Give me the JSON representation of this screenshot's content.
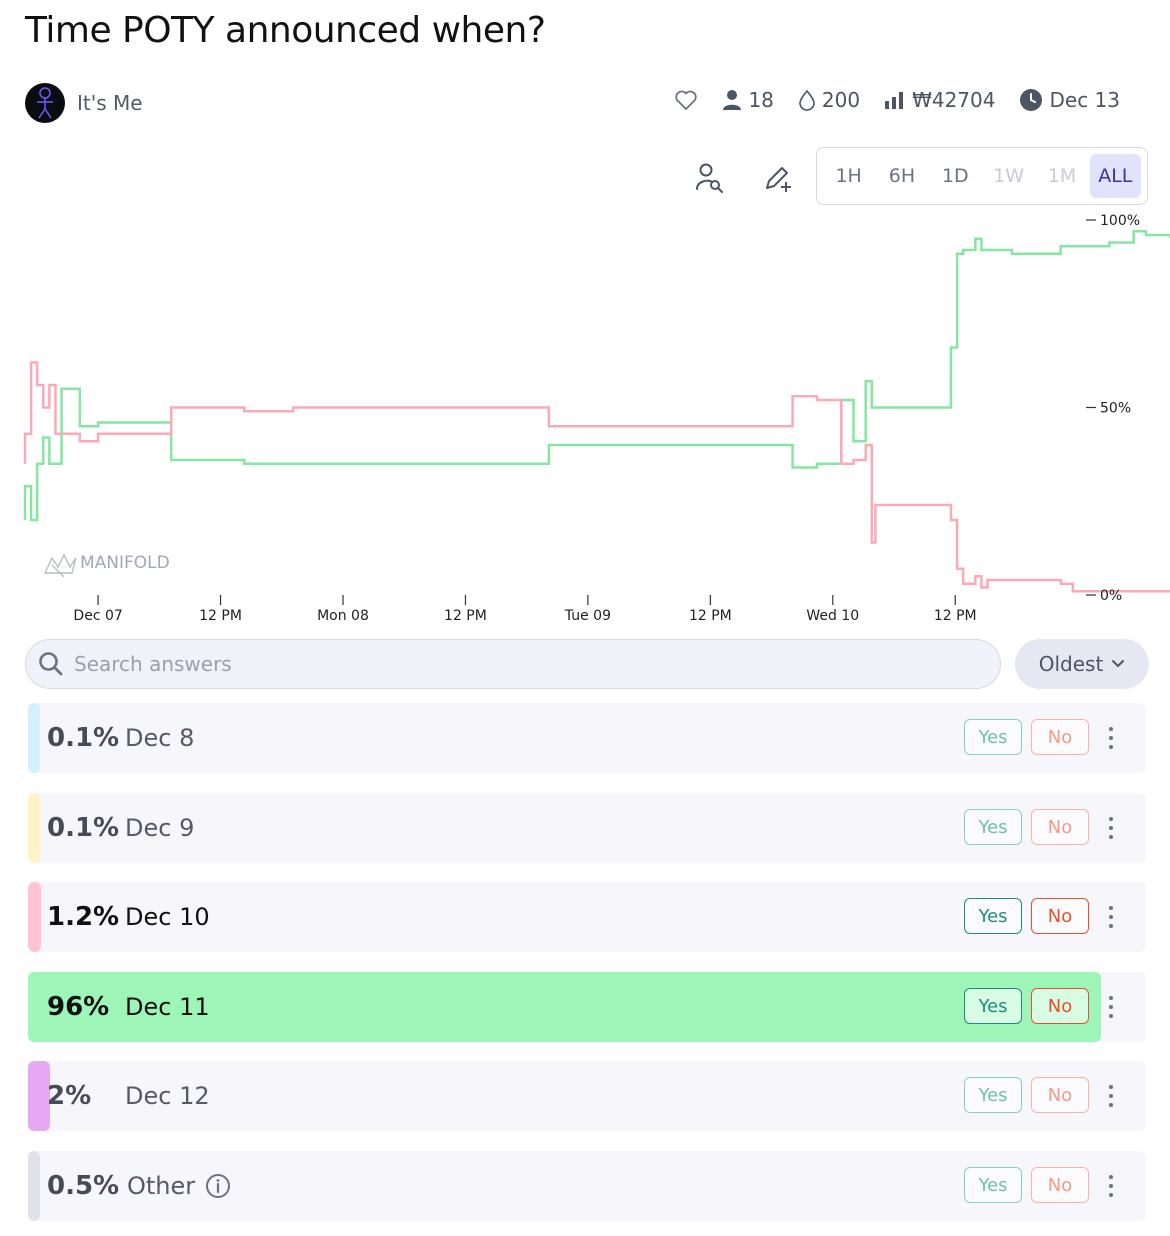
{
  "title": "Time POTY announced when?",
  "author": {
    "name": "It's Me"
  },
  "stats": {
    "traders": "18",
    "liquidity": "200",
    "volume": "₩42704",
    "close_date": "Dec 13"
  },
  "periods": [
    {
      "label": "1H",
      "state": "disabled-ish"
    },
    {
      "label": "6H",
      "state": "enabled"
    },
    {
      "label": "1D",
      "state": "enabled"
    },
    {
      "label": "1W",
      "state": "disabled"
    },
    {
      "label": "1M",
      "state": "disabled"
    },
    {
      "label": "ALL",
      "state": "active"
    }
  ],
  "chart_data": {
    "type": "line",
    "watermark": "MANIFOLD",
    "x_tick_labels": [
      "Dec 07",
      "12 PM",
      "Mon 08",
      "12 PM",
      "Tue 09",
      "12 PM",
      "Wed 10",
      "12 PM"
    ],
    "y_tick_labels": [
      "100%",
      "50%",
      "0%"
    ],
    "ylim": [
      0,
      100
    ],
    "x_unit": "hours since start of chart",
    "xlim": [
      0,
      87
    ],
    "series": [
      {
        "color": "#86e5a0",
        "points": [
          [
            0,
            20
          ],
          [
            0,
            29
          ],
          [
            0.5,
            29
          ],
          [
            0.5,
            20
          ],
          [
            1,
            20
          ],
          [
            1,
            35
          ],
          [
            1.5,
            35
          ],
          [
            1.5,
            42
          ],
          [
            2,
            42
          ],
          [
            2,
            35
          ],
          [
            3,
            35
          ],
          [
            3,
            55
          ],
          [
            4.5,
            55
          ],
          [
            4.5,
            45
          ],
          [
            6,
            45
          ],
          [
            6,
            46
          ],
          [
            12,
            46
          ],
          [
            12,
            36
          ],
          [
            18,
            36
          ],
          [
            18,
            35
          ],
          [
            43,
            35
          ],
          [
            43,
            40
          ],
          [
            63,
            40
          ],
          [
            63,
            34
          ],
          [
            65,
            34
          ],
          [
            65,
            35
          ],
          [
            67,
            35
          ],
          [
            67,
            52
          ],
          [
            68,
            52
          ],
          [
            68,
            41
          ],
          [
            69,
            41
          ],
          [
            69,
            57
          ],
          [
            69.5,
            57
          ],
          [
            69.5,
            50
          ],
          [
            76,
            50
          ],
          [
            76,
            66
          ],
          [
            76.5,
            66
          ],
          [
            76.5,
            91
          ],
          [
            77,
            91
          ],
          [
            77,
            92
          ],
          [
            78,
            92
          ],
          [
            78,
            95
          ],
          [
            78.5,
            95
          ],
          [
            78.5,
            92
          ],
          [
            81,
            92
          ],
          [
            81,
            91
          ],
          [
            85,
            91
          ],
          [
            85,
            93
          ],
          [
            89,
            93
          ],
          [
            89,
            94
          ],
          [
            91,
            94
          ],
          [
            91,
            97
          ],
          [
            92,
            97
          ],
          [
            92,
            96
          ],
          [
            94,
            96
          ],
          [
            94,
            95.5
          ],
          [
            100,
            95.5
          ]
        ]
      },
      {
        "color": "#f9aab7",
        "points": [
          [
            0,
            35
          ],
          [
            0,
            43
          ],
          [
            0.5,
            43
          ],
          [
            0.5,
            62
          ],
          [
            1,
            62
          ],
          [
            1,
            56
          ],
          [
            1.5,
            56
          ],
          [
            1.5,
            50
          ],
          [
            2,
            50
          ],
          [
            2,
            56
          ],
          [
            2.5,
            56
          ],
          [
            2.5,
            43
          ],
          [
            4.5,
            43
          ],
          [
            4.5,
            41
          ],
          [
            6,
            41
          ],
          [
            6,
            43
          ],
          [
            12,
            43
          ],
          [
            12,
            50
          ],
          [
            18,
            50
          ],
          [
            18,
            49
          ],
          [
            22,
            49
          ],
          [
            22,
            50
          ],
          [
            43,
            50
          ],
          [
            43,
            45
          ],
          [
            63,
            45
          ],
          [
            63,
            53
          ],
          [
            65,
            53
          ],
          [
            65,
            52
          ],
          [
            67,
            52
          ],
          [
            67,
            35
          ],
          [
            68,
            35
          ],
          [
            68,
            36
          ],
          [
            69,
            36
          ],
          [
            69,
            40
          ],
          [
            69.5,
            40
          ],
          [
            69.5,
            14
          ],
          [
            69.8,
            14
          ],
          [
            69.8,
            24
          ],
          [
            76,
            24
          ],
          [
            76,
            20
          ],
          [
            76.5,
            20
          ],
          [
            76.5,
            7
          ],
          [
            77,
            7
          ],
          [
            77,
            3
          ],
          [
            78,
            3
          ],
          [
            78,
            5
          ],
          [
            78.5,
            5
          ],
          [
            78.5,
            2
          ],
          [
            79,
            2
          ],
          [
            79,
            4
          ],
          [
            85,
            4
          ],
          [
            85,
            3
          ],
          [
            86,
            3
          ],
          [
            86,
            1
          ],
          [
            100,
            1
          ]
        ]
      }
    ]
  },
  "search": {
    "placeholder": "Search answers"
  },
  "sort": {
    "label": "Oldest"
  },
  "answers": [
    {
      "prob": "0.1%",
      "label": "Dec 8",
      "color": "#d4efff",
      "prob_value": 0.001,
      "yes": "Yes",
      "no": "No"
    },
    {
      "prob": "0.1%",
      "label": "Dec 9",
      "color": "#fff2c8",
      "prob_value": 0.001,
      "yes": "Yes",
      "no": "No"
    },
    {
      "prob": "1.2%",
      "label": "Dec 10",
      "color": "#ffc4cf",
      "prob_value": 0.012,
      "yes": "Yes",
      "no": "No"
    },
    {
      "prob": "96%",
      "label": "Dec 11",
      "color": "#9ef5b8",
      "prob_value": 0.96,
      "yes": "Yes",
      "no": "No"
    },
    {
      "prob": "2%",
      "label": "Dec 12",
      "color": "#e7a8f3",
      "prob_value": 0.02,
      "yes": "Yes",
      "no": "No"
    },
    {
      "prob": "0.5%",
      "label": "Other",
      "color": "#e0e1ea",
      "prob_value": 0.005,
      "yes": "Yes",
      "no": "No"
    }
  ]
}
